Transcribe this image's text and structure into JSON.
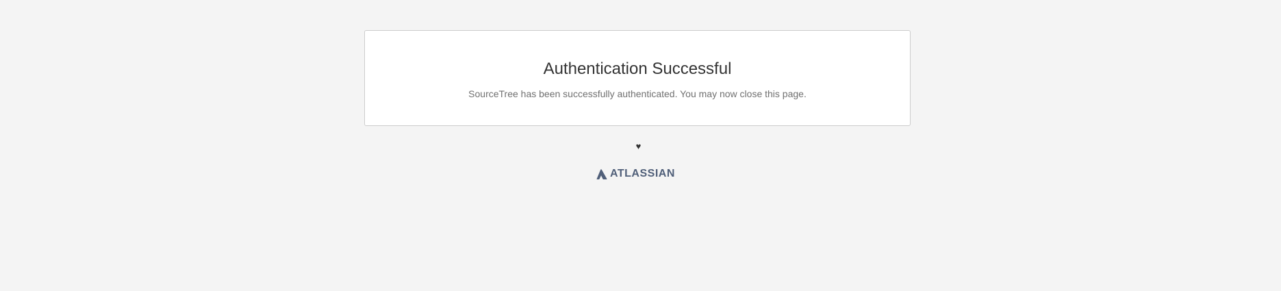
{
  "card": {
    "title": "Authentication Successful",
    "message": "SourceTree has been successfully authenticated. You may now close this page."
  },
  "footer": {
    "heart_icon": "heart-icon",
    "heart_glyph": "♥",
    "logo_icon": "atlassian-logo-icon",
    "logo_text": "ATLASSIAN"
  },
  "colors": {
    "background": "#f4f4f4",
    "card_background": "#ffffff",
    "card_border": "#cccccc",
    "title": "#333333",
    "message": "#707070",
    "logo": "#505f79"
  }
}
